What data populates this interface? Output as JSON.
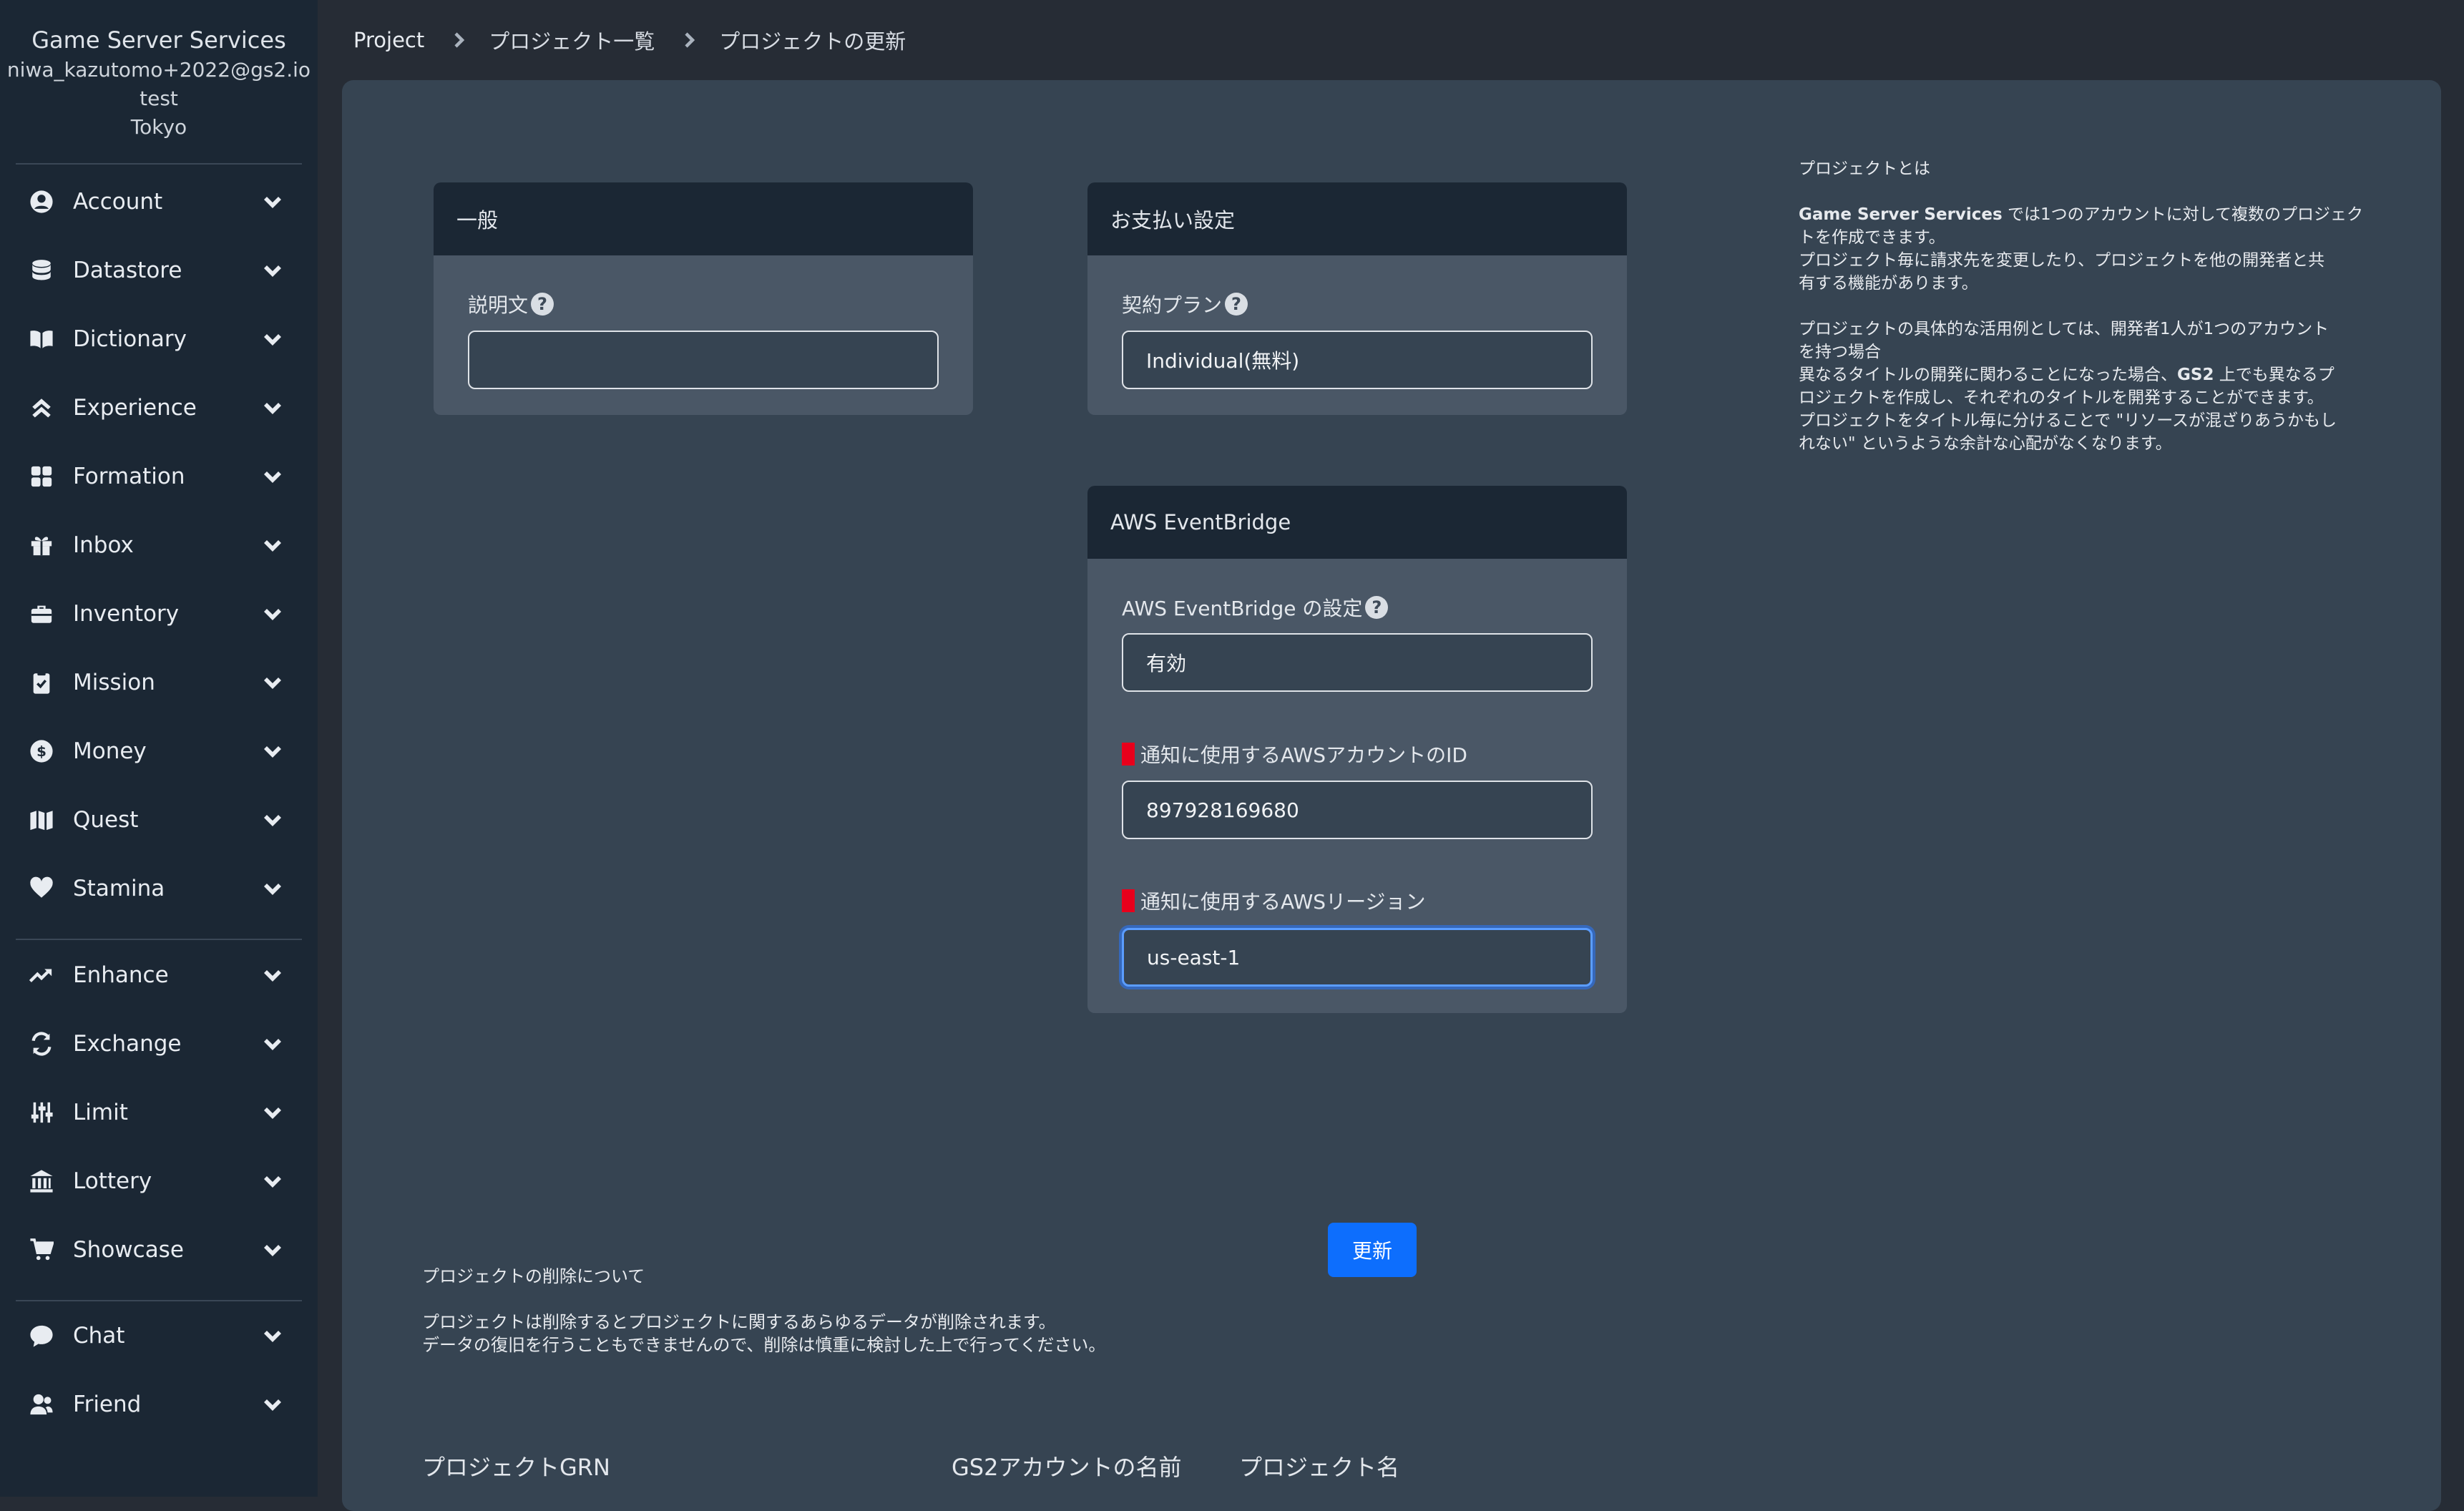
{
  "sidebar": {
    "brand": "Game Server Services",
    "user_email": "niwa_kazutomo+2022@gs2.io",
    "project": "test",
    "region": "Tokyo",
    "group1": [
      {
        "label": "Account",
        "icon": "user-circle-icon"
      },
      {
        "label": "Datastore",
        "icon": "database-icon"
      },
      {
        "label": "Dictionary",
        "icon": "book-open-icon"
      },
      {
        "label": "Experience",
        "icon": "angles-up-icon"
      },
      {
        "label": "Formation",
        "icon": "grid-icon"
      },
      {
        "label": "Inbox",
        "icon": "gift-icon"
      },
      {
        "label": "Inventory",
        "icon": "briefcase-icon"
      },
      {
        "label": "Mission",
        "icon": "clipboard-check-icon"
      },
      {
        "label": "Money",
        "icon": "dollar-circle-icon"
      },
      {
        "label": "Quest",
        "icon": "map-icon"
      },
      {
        "label": "Stamina",
        "icon": "heart-icon"
      }
    ],
    "group2": [
      {
        "label": "Enhance",
        "icon": "trend-up-icon"
      },
      {
        "label": "Exchange",
        "icon": "exchange-icon"
      },
      {
        "label": "Limit",
        "icon": "sliders-icon"
      },
      {
        "label": "Lottery",
        "icon": "bank-icon"
      },
      {
        "label": "Showcase",
        "icon": "cart-icon"
      }
    ],
    "group3": [
      {
        "label": "Chat",
        "icon": "chat-icon"
      },
      {
        "label": "Friend",
        "icon": "users-icon"
      }
    ]
  },
  "breadcrumb": [
    "Project",
    "プロジェクト一覧",
    "プロジェクトの更新"
  ],
  "general_card": {
    "header": "一般",
    "description_label": "説明文",
    "description_value": ""
  },
  "payment_card": {
    "header": "お支払い設定",
    "plan_label": "契約プラン",
    "plan_value": "Individual(無料)"
  },
  "eventbridge_card": {
    "header": "AWS EventBridge",
    "setting_label": "AWS EventBridge の設定",
    "setting_value": "有効",
    "account_id_label": "通知に使用するAWSアカウントのID",
    "account_id_value": "897928169680",
    "region_label": "通知に使用するAWSリージョン",
    "region_value": "us-east-1"
  },
  "update_button": "更新",
  "help": {
    "title": "プロジェクトとは",
    "p1_brand": "Game Server Services",
    "p1_a": " では1つのアカウントに対して複数のプロジェク",
    "p1_b": "トを作成できます。",
    "p1_c": "プロジェクト毎に請求先を変更したり、プロジェクトを他の開発者と共",
    "p1_d": "有する機能があります。",
    "p2_a": "プロジェクトの具体的な活用例としては、開発者1人が1つのアカウント",
    "p2_b": "を持つ場合",
    "p2_c_pre": "異なるタイトルの開発に関わることになった場合、",
    "p2_c_brand": "GS2",
    "p2_c_post": " 上でも異なるプ",
    "p2_d": "ロジェクトを作成し、それぞれのタイトルを開発することができます。",
    "p2_e": "プロジェクトをタイトル毎に分けることで \"リソースが混ざりあうかもし",
    "p2_f": "れない\" というような余計な心配がなくなります。"
  },
  "delete_info": {
    "title": "プロジェクトの削除について",
    "line1": "プロジェクトは削除するとプロジェクトに関するあらゆるデータが削除されます。",
    "line2": "データの復旧を行うこともできませんので、削除は慎重に検討した上で行ってください。"
  },
  "meta": {
    "grn_label": "プロジェクトGRN",
    "account_label": "GS2アカウントの名前",
    "project_label": "プロジェクト名"
  }
}
